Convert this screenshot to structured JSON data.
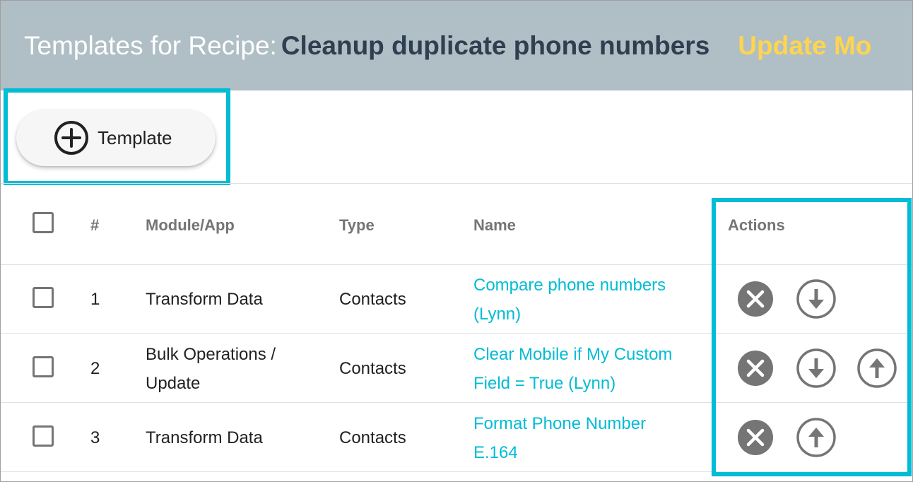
{
  "header": {
    "title_prefix": "Templates for Recipe:",
    "recipe_name": "Cleanup duplicate phone numbers",
    "mode_link": "Update Mo"
  },
  "toolbar": {
    "add_template_label": "Template",
    "add_icon": "plus-circle-icon"
  },
  "table": {
    "columns": {
      "index": "#",
      "module": "Module/App",
      "type": "Type",
      "name": "Name",
      "actions": "Actions"
    },
    "rows": [
      {
        "index": "1",
        "module_line1": "Transform Data",
        "module_line2": "",
        "type": "Contacts",
        "name_line1": "Compare phone numbers",
        "name_line2": "(Lynn)",
        "actions": [
          "delete-icon",
          "move-down-icon"
        ]
      },
      {
        "index": "2",
        "module_line1": "Bulk Operations /",
        "module_line2": "Update",
        "type": "Contacts",
        "name_line1": "Clear Mobile if My Custom",
        "name_line2": "Field = True (Lynn)",
        "actions": [
          "delete-icon",
          "move-down-icon",
          "move-up-icon"
        ]
      },
      {
        "index": "3",
        "module_line1": "Transform Data",
        "module_line2": "",
        "type": "Contacts",
        "name_line1": "Format Phone Number",
        "name_line2": "E.164",
        "actions": [
          "delete-icon",
          "move-up-icon"
        ]
      }
    ]
  },
  "colors": {
    "header_bg": "#b0bec5",
    "recipe_name": "#2f3e50",
    "mode_link": "#ffd54f",
    "link": "#00bcd4",
    "highlight": "#00bcd4",
    "icon_gray": "#757575"
  }
}
